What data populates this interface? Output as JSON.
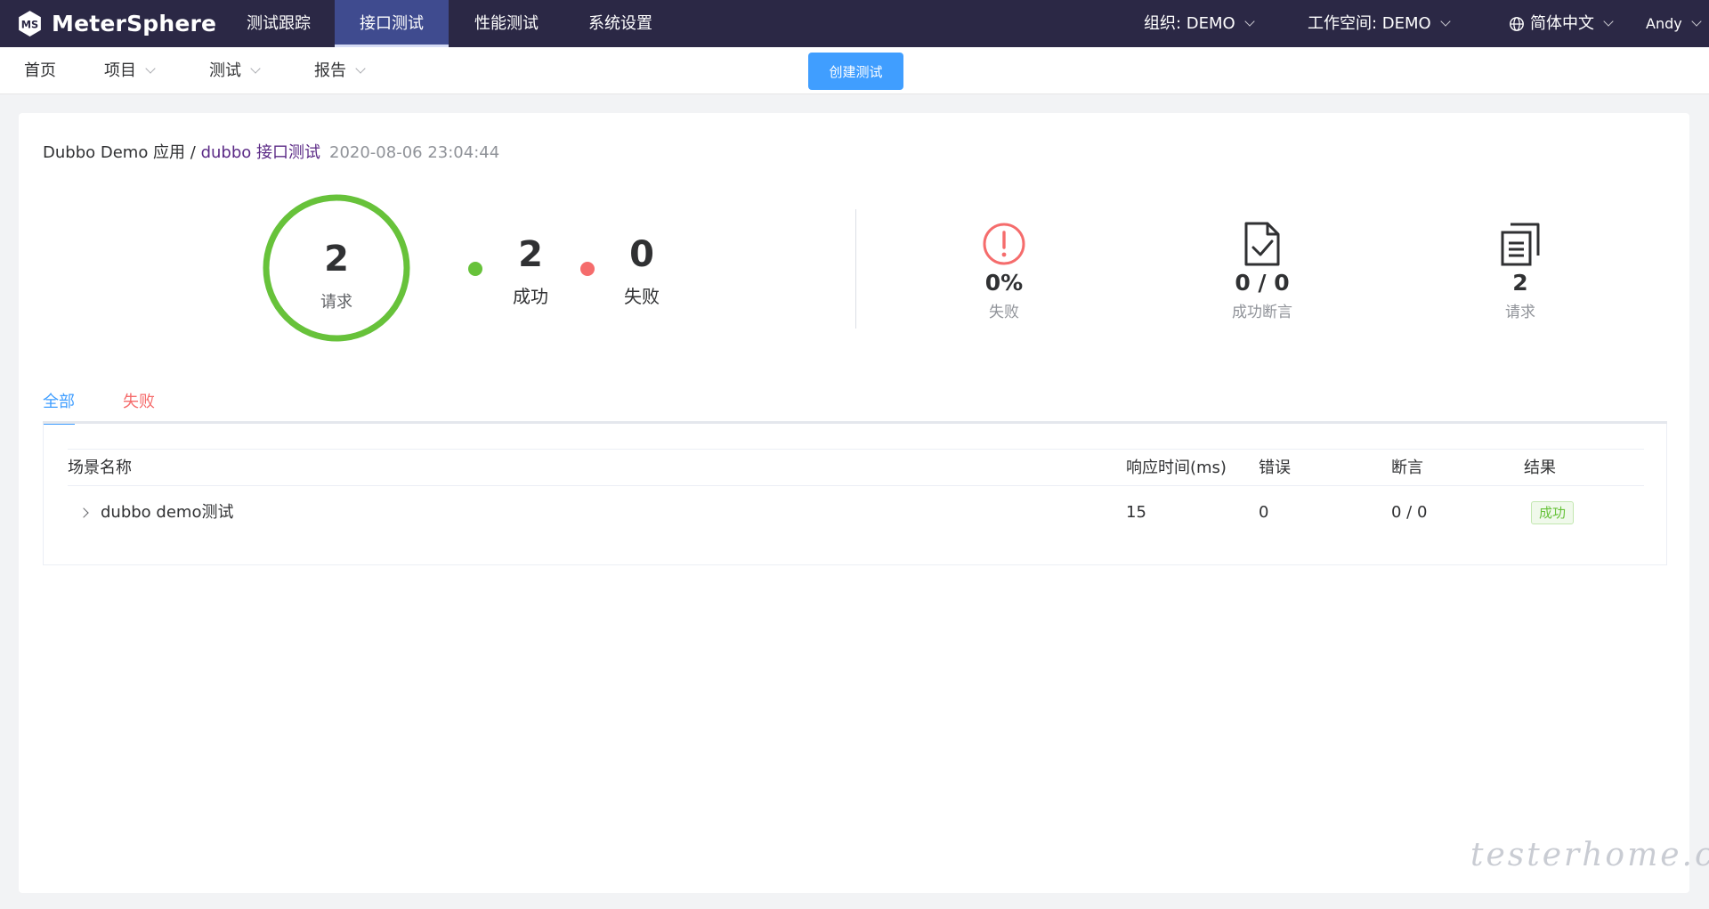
{
  "app": {
    "name": "MeterSphere"
  },
  "topnav": {
    "items": [
      "测试跟踪",
      "接口测试",
      "性能测试",
      "系统设置"
    ],
    "active_index": 1
  },
  "org_label": "组织: DEMO",
  "workspace_label": "工作空间: DEMO",
  "language_label": "简体中文",
  "user_label": "Andy",
  "subnav": {
    "home": "首页",
    "project": "项目",
    "test": "测试",
    "report": "报告",
    "create_button": "创建测试"
  },
  "report": {
    "project": "Dubbo Demo 应用",
    "separator": " / ",
    "test_name": "dubbo 接口测试",
    "time": "2020-08-06 23:04:44",
    "total_requests": "2",
    "total_label": "请求",
    "success_count": "2",
    "success_label": "成功",
    "fail_count": "0",
    "fail_label": "失败",
    "success_ratio": 1.0
  },
  "kpis": [
    {
      "icon": "alert-circle-icon",
      "value": "0%",
      "label": "失败"
    },
    {
      "icon": "document-check-icon",
      "value": "0 / 0",
      "label": "成功断言"
    },
    {
      "icon": "copy-document-icon",
      "value": "2",
      "label": "请求"
    }
  ],
  "tabs": {
    "all": "全部",
    "fail": "失败"
  },
  "table": {
    "headers": [
      "场景名称",
      "响应时间(ms)",
      "错误",
      "断言",
      "结果"
    ],
    "rows": [
      {
        "name": "dubbo demo测试",
        "response_time": "15",
        "errors": "0",
        "assertions": "0 / 0",
        "result": "成功"
      }
    ]
  },
  "watermark": "testerhome.com",
  "colors": {
    "topbar": "#2b2845",
    "primary": "#409eff",
    "success": "#67c23a",
    "danger": "#f56c6c",
    "ring": "#67c23a"
  }
}
